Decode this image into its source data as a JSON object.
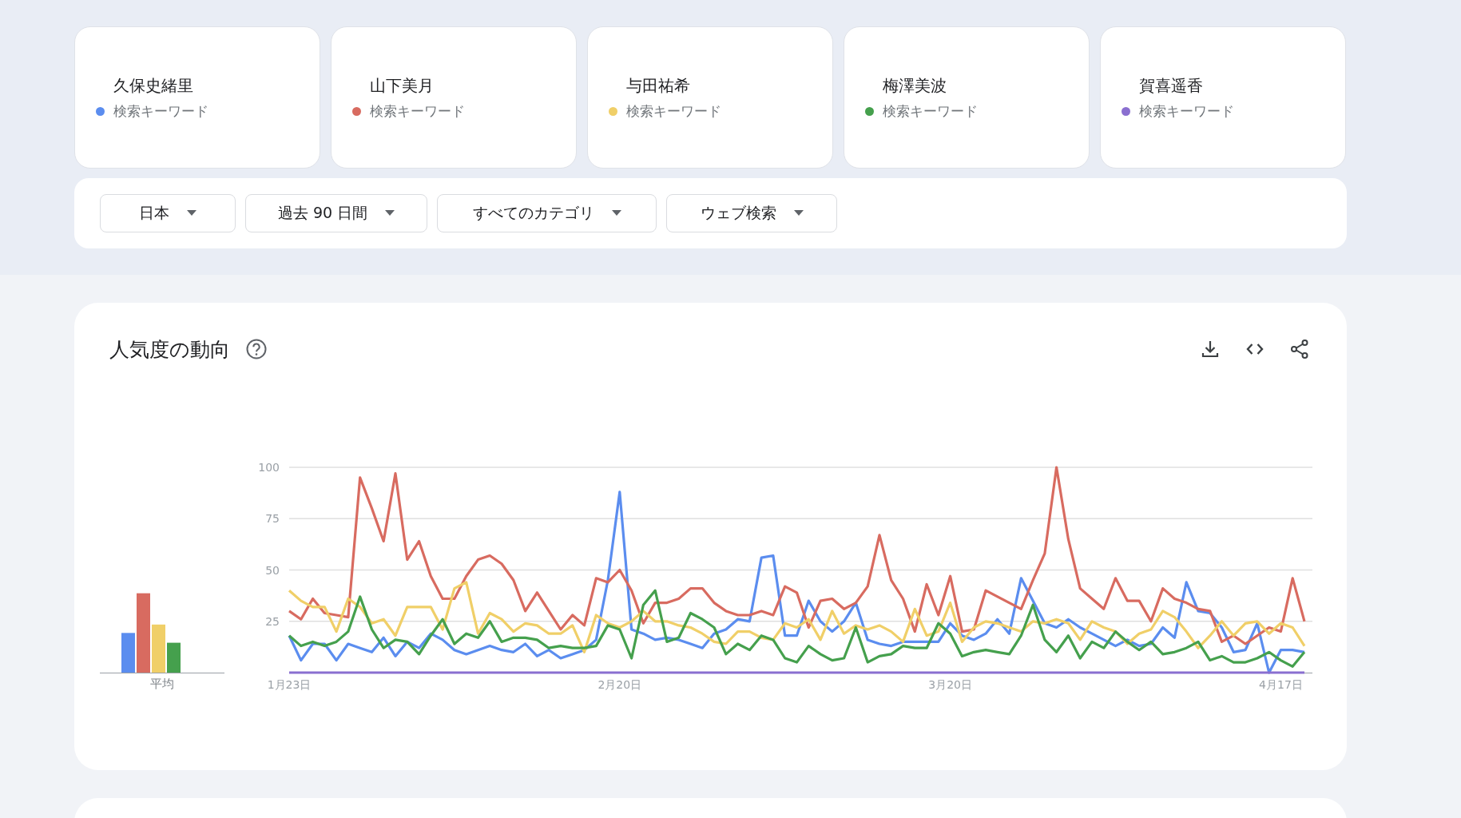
{
  "terms": [
    {
      "name": "久保史緒里",
      "subtitle": "検索キーワード",
      "color": "#5b8def"
    },
    {
      "name": "山下美月",
      "subtitle": "検索キーワード",
      "color": "#d86b60"
    },
    {
      "name": "与田祐希",
      "subtitle": "検索キーワード",
      "color": "#f0cf68"
    },
    {
      "name": "梅澤美波",
      "subtitle": "検索キーワード",
      "color": "#45a04d"
    },
    {
      "name": "賀喜遥香",
      "subtitle": "検索キーワード",
      "color": "#8a6fd0"
    }
  ],
  "filters": [
    {
      "label": "日本"
    },
    {
      "label": "過去 90 日間"
    },
    {
      "label": "すべてのカテゴリ"
    },
    {
      "label": "ウェブ検索"
    }
  ],
  "interest_panel": {
    "title": "人気度の動向",
    "average_label": "平均",
    "chart_data": {
      "type": "line",
      "grid": true,
      "categories": [
        "1月23日",
        null,
        null,
        null,
        null,
        null,
        null,
        null,
        null,
        null,
        null,
        null,
        null,
        null,
        null,
        null,
        null,
        null,
        null,
        null,
        null,
        null,
        null,
        null,
        null,
        null,
        null,
        null,
        "2月20日",
        null,
        null,
        null,
        null,
        null,
        null,
        null,
        null,
        null,
        null,
        null,
        null,
        null,
        null,
        null,
        null,
        null,
        null,
        null,
        null,
        null,
        null,
        null,
        null,
        null,
        null,
        null,
        "3月20日",
        null,
        null,
        null,
        null,
        null,
        null,
        null,
        null,
        null,
        null,
        null,
        null,
        null,
        null,
        null,
        null,
        null,
        null,
        null,
        null,
        null,
        null,
        null,
        null,
        null,
        null,
        null,
        "4月17日",
        null,
        null
      ],
      "ylim": [
        0,
        100
      ],
      "yticks": [
        25,
        50,
        75,
        100
      ],
      "series": [
        {
          "color": "#5b8def",
          "values": [
            18,
            6,
            14,
            14,
            6,
            14,
            12,
            10,
            17,
            8,
            15,
            12,
            19,
            16,
            11,
            9,
            11,
            13,
            11,
            10,
            14,
            8,
            11,
            7,
            9,
            11,
            16,
            45,
            88,
            21,
            19,
            16,
            17,
            16,
            14,
            12,
            19,
            21,
            26,
            25,
            56,
            57,
            18,
            18,
            35,
            25,
            20,
            25,
            34,
            16,
            14,
            13,
            15,
            15,
            15,
            15,
            24,
            18,
            16,
            19,
            26,
            19,
            46,
            35,
            24,
            22,
            26,
            22,
            19,
            16,
            13,
            16,
            13,
            14,
            22,
            17,
            44,
            30,
            29,
            22,
            10,
            11,
            24,
            0,
            11,
            11,
            10
          ]
        },
        {
          "color": "#d86b60",
          "values": [
            30,
            26,
            36,
            29,
            28,
            27,
            95,
            80,
            64,
            97,
            55,
            64,
            47,
            36,
            36,
            47,
            55,
            57,
            53,
            45,
            30,
            39,
            30,
            21,
            28,
            23,
            46,
            44,
            50,
            40,
            24,
            34,
            34,
            36,
            41,
            41,
            34,
            30,
            28,
            28,
            30,
            28,
            42,
            39,
            22,
            35,
            36,
            31,
            34,
            42,
            67,
            45,
            36,
            20,
            43,
            28,
            47,
            20,
            21,
            40,
            37,
            34,
            31,
            45,
            58,
            100,
            65,
            41,
            36,
            31,
            46,
            35,
            35,
            25,
            41,
            36,
            34,
            31,
            30,
            15,
            18,
            14,
            18,
            22,
            20,
            46,
            25
          ]
        },
        {
          "color": "#f0cf68",
          "values": [
            40,
            35,
            32,
            32,
            20,
            36,
            32,
            24,
            26,
            18,
            32,
            32,
            32,
            21,
            41,
            44,
            19,
            29,
            26,
            20,
            24,
            23,
            19,
            19,
            23,
            10,
            28,
            24,
            22,
            25,
            30,
            25,
            25,
            23,
            22,
            19,
            15,
            14,
            20,
            20,
            17,
            16,
            24,
            22,
            26,
            16,
            30,
            19,
            23,
            21,
            23,
            20,
            15,
            31,
            18,
            20,
            34,
            15,
            22,
            25,
            24,
            22,
            20,
            25,
            24,
            26,
            24,
            16,
            25,
            22,
            20,
            14,
            19,
            21,
            30,
            27,
            20,
            12,
            18,
            25,
            18,
            24,
            25,
            19,
            24,
            22,
            13
          ]
        },
        {
          "color": "#45a04d",
          "values": [
            18,
            13,
            15,
            13,
            15,
            20,
            37,
            21,
            12,
            16,
            15,
            9,
            18,
            26,
            14,
            19,
            17,
            25,
            15,
            17,
            17,
            16,
            12,
            13,
            12,
            12,
            13,
            23,
            21,
            7,
            33,
            40,
            15,
            17,
            29,
            26,
            22,
            9,
            14,
            11,
            18,
            16,
            7,
            5,
            13,
            9,
            6,
            7,
            22,
            5,
            8,
            9,
            13,
            12,
            12,
            24,
            19,
            8,
            10,
            11,
            10,
            9,
            18,
            33,
            16,
            10,
            18,
            7,
            15,
            12,
            20,
            15,
            11,
            15,
            9,
            10,
            12,
            15,
            6,
            8,
            5,
            5,
            7,
            10,
            6,
            3,
            10
          ]
        },
        {
          "color": "#8a6fd0",
          "values": [
            0,
            0,
            0,
            0,
            0,
            0,
            0,
            0,
            0,
            0,
            0,
            0,
            0,
            0,
            0,
            0,
            0,
            0,
            0,
            0,
            0,
            0,
            0,
            0,
            0,
            0,
            0,
            0,
            0,
            0,
            0,
            0,
            0,
            0,
            0,
            0,
            0,
            0,
            0,
            0,
            0,
            0,
            0,
            0,
            0,
            0,
            0,
            0,
            0,
            0,
            0,
            0,
            0,
            0,
            0,
            0,
            0,
            0,
            0,
            0,
            0,
            0,
            0,
            0,
            0,
            0,
            0,
            0,
            0,
            0,
            0,
            0,
            0,
            0,
            0,
            0,
            0,
            0,
            0,
            0,
            0,
            0,
            0,
            0,
            0,
            0,
            0
          ]
        }
      ]
    }
  }
}
